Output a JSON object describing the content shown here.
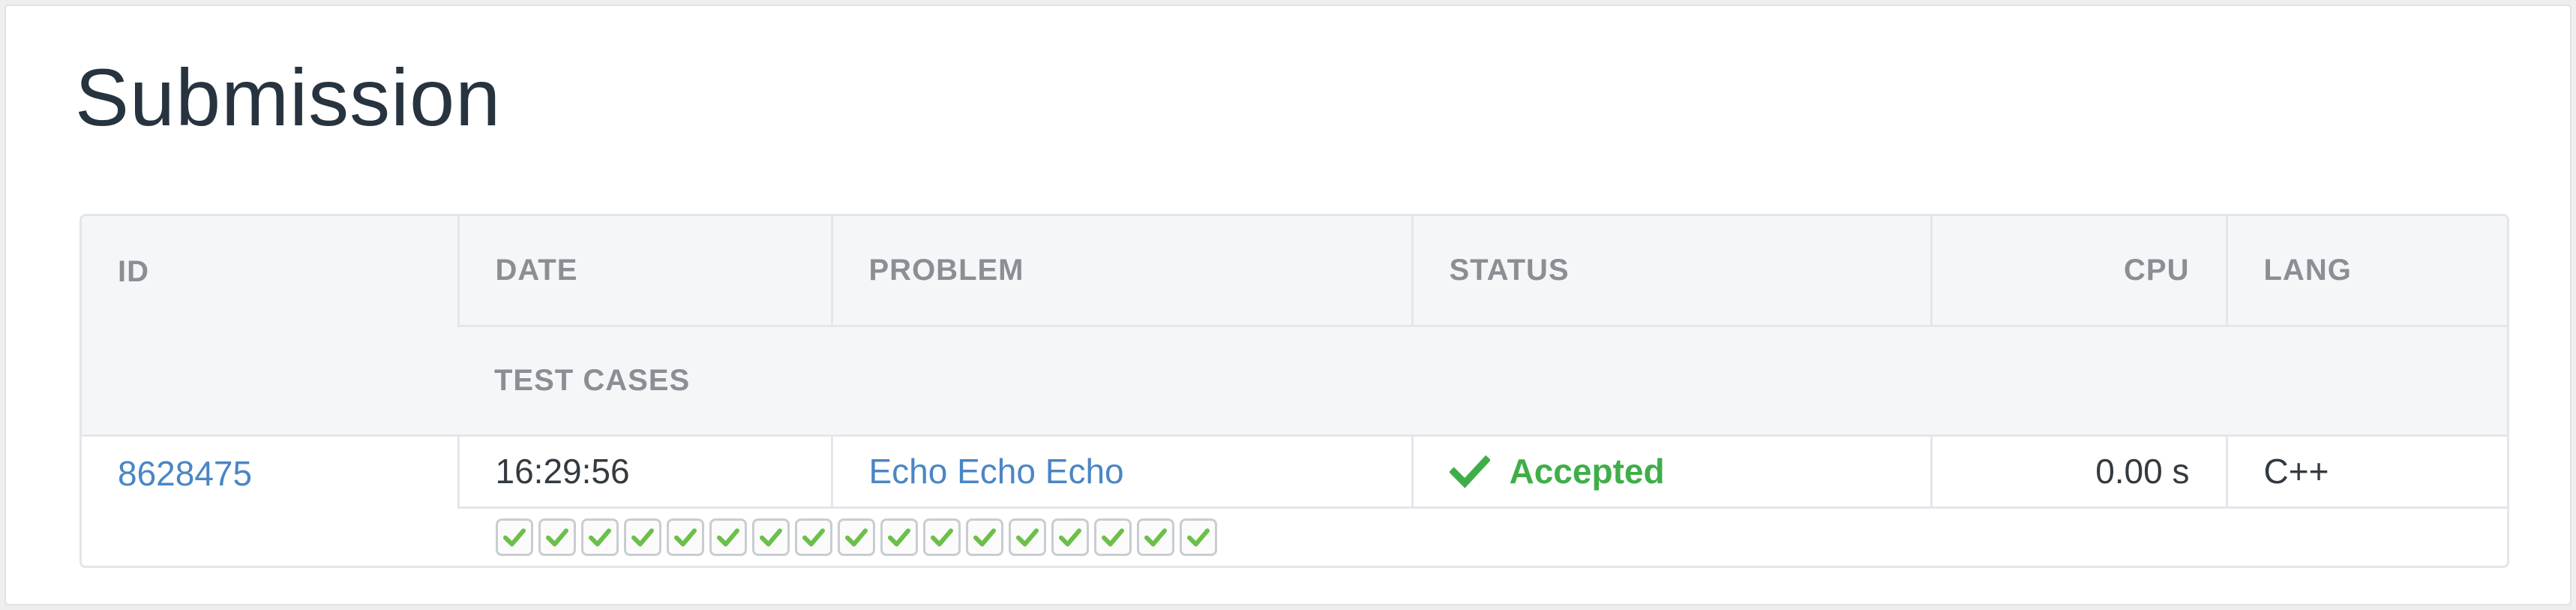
{
  "page": {
    "title": "Submission"
  },
  "table": {
    "headers": {
      "id": "ID",
      "date": "DATE",
      "problem": "PROBLEM",
      "status": "STATUS",
      "cpu": "CPU",
      "lang": "LANG",
      "test_cases": "TEST CASES"
    },
    "row": {
      "id": "8628475",
      "date": "16:29:56",
      "problem": "Echo Echo Echo",
      "status": "Accepted",
      "status_icon": "check-icon",
      "cpu": "0.00 s",
      "lang": "C++",
      "test_cases": [
        "passed",
        "passed",
        "passed",
        "passed",
        "passed",
        "passed",
        "passed",
        "passed",
        "passed",
        "passed",
        "passed",
        "passed",
        "passed",
        "passed",
        "passed",
        "passed",
        "passed"
      ]
    }
  },
  "colors": {
    "accepted": "#3fae49",
    "link": "#4a86c5",
    "case_check": "#6cc04a",
    "header_bg": "#f5f6f8",
    "header_text": "#8a8f95"
  }
}
